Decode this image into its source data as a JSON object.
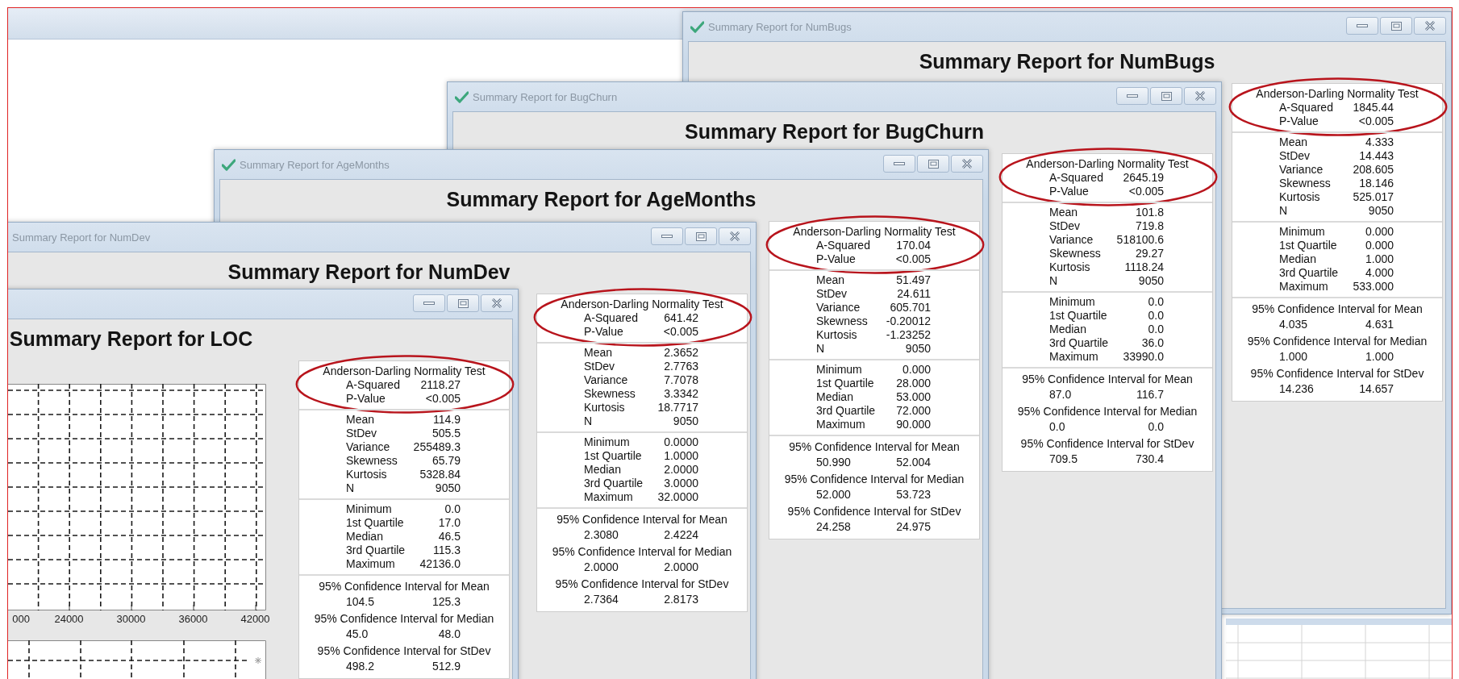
{
  "windows": [
    {
      "title": "Summary Report for NumBugs",
      "title_icon": true,
      "heading": "Summary Report for NumBugs",
      "sections": [
        {
          "kind": "test",
          "title": "Anderson-Darling Normality Test",
          "highlighted": true,
          "rows": [
            [
              "A-Squared",
              "1845.44"
            ],
            [
              "P-Value",
              "<0.005"
            ]
          ]
        },
        {
          "kind": "rows",
          "rows": [
            [
              "Mean",
              "4.333"
            ],
            [
              "StDev",
              "14.443"
            ],
            [
              "Variance",
              "208.605"
            ],
            [
              "Skewness",
              "18.146"
            ],
            [
              "Kurtosis",
              "525.017"
            ],
            [
              "N",
              "9050"
            ]
          ]
        },
        {
          "kind": "rows",
          "rows": [
            [
              "Minimum",
              "0.000"
            ],
            [
              "1st Quartile",
              "0.000"
            ],
            [
              "Median",
              "1.000"
            ],
            [
              "3rd Quartile",
              "4.000"
            ],
            [
              "Maximum",
              "533.000"
            ]
          ]
        },
        {
          "kind": "intervals",
          "items": [
            {
              "title": "95% Confidence Interval for Mean",
              "low": "4.035",
              "high": "4.631"
            },
            {
              "title": "95% Confidence Interval for Median",
              "low": "1.000",
              "high": "1.000"
            },
            {
              "title": "95% Confidence Interval for StDev",
              "low": "14.236",
              "high": "14.657"
            }
          ]
        }
      ]
    },
    {
      "title": "Summary Report for BugChurn",
      "title_icon": true,
      "heading": "Summary Report for BugChurn",
      "sections": [
        {
          "kind": "test",
          "title": "Anderson-Darling Normality Test",
          "highlighted": true,
          "rows": [
            [
              "A-Squared",
              "2645.19"
            ],
            [
              "P-Value",
              "<0.005"
            ]
          ]
        },
        {
          "kind": "rows",
          "rows": [
            [
              "Mean",
              "101.8"
            ],
            [
              "StDev",
              "719.8"
            ],
            [
              "Variance",
              "518100.6"
            ],
            [
              "Skewness",
              "29.27"
            ],
            [
              "Kurtosis",
              "1118.24"
            ],
            [
              "N",
              "9050"
            ]
          ]
        },
        {
          "kind": "rows",
          "rows": [
            [
              "Minimum",
              "0.0"
            ],
            [
              "1st Quartile",
              "0.0"
            ],
            [
              "Median",
              "0.0"
            ],
            [
              "3rd Quartile",
              "36.0"
            ],
            [
              "Maximum",
              "33990.0"
            ]
          ]
        },
        {
          "kind": "intervals",
          "items": [
            {
              "title": "95% Confidence Interval for Mean",
              "low": "87.0",
              "high": "116.7"
            },
            {
              "title": "95% Confidence Interval for Median",
              "low": "0.0",
              "high": "0.0"
            },
            {
              "title": "95% Confidence Interval for StDev",
              "low": "709.5",
              "high": "730.4"
            }
          ]
        }
      ]
    },
    {
      "title": "Summary Report for AgeMonths",
      "title_icon": true,
      "heading": "Summary Report for AgeMonths",
      "sections": [
        {
          "kind": "test",
          "title": "Anderson-Darling Normality Test",
          "highlighted": true,
          "rows": [
            [
              "A-Squared",
              "170.04"
            ],
            [
              "P-Value",
              "<0.005"
            ]
          ]
        },
        {
          "kind": "rows",
          "rows": [
            [
              "Mean",
              "51.497"
            ],
            [
              "StDev",
              "24.611"
            ],
            [
              "Variance",
              "605.701"
            ],
            [
              "Skewness",
              "-0.20012"
            ],
            [
              "Kurtosis",
              "-1.23252"
            ],
            [
              "N",
              "9050"
            ]
          ]
        },
        {
          "kind": "rows",
          "rows": [
            [
              "Minimum",
              "0.000"
            ],
            [
              "1st Quartile",
              "28.000"
            ],
            [
              "Median",
              "53.000"
            ],
            [
              "3rd Quartile",
              "72.000"
            ],
            [
              "Maximum",
              "90.000"
            ]
          ]
        },
        {
          "kind": "intervals",
          "items": [
            {
              "title": "95% Confidence Interval for Mean",
              "low": "50.990",
              "high": "52.004"
            },
            {
              "title": "95% Confidence Interval for Median",
              "low": "52.000",
              "high": "53.723"
            },
            {
              "title": "95% Confidence Interval for StDev",
              "low": "24.258",
              "high": "24.975"
            }
          ]
        }
      ]
    },
    {
      "title": "Summary Report for NumDev",
      "title_icon": false,
      "heading": "Summary Report for NumDev",
      "sections": [
        {
          "kind": "test",
          "title": "Anderson-Darling Normality Test",
          "highlighted": true,
          "rows": [
            [
              "A-Squared",
              "641.42"
            ],
            [
              "P-Value",
              "<0.005"
            ]
          ]
        },
        {
          "kind": "rows",
          "rows": [
            [
              "Mean",
              "2.3652"
            ],
            [
              "StDev",
              "2.7763"
            ],
            [
              "Variance",
              "7.7078"
            ],
            [
              "Skewness",
              "3.3342"
            ],
            [
              "Kurtosis",
              "18.7717"
            ],
            [
              "N",
              "9050"
            ]
          ]
        },
        {
          "kind": "rows",
          "rows": [
            [
              "Minimum",
              "0.0000"
            ],
            [
              "1st Quartile",
              "1.0000"
            ],
            [
              "Median",
              "2.0000"
            ],
            [
              "3rd Quartile",
              "3.0000"
            ],
            [
              "Maximum",
              "32.0000"
            ]
          ]
        },
        {
          "kind": "intervals",
          "items": [
            {
              "title": "95% Confidence Interval for Mean",
              "low": "2.3080",
              "high": "2.4224"
            },
            {
              "title": "95% Confidence Interval for Median",
              "low": "2.0000",
              "high": "2.0000"
            },
            {
              "title": "95% Confidence Interval for StDev",
              "low": "2.7364",
              "high": "2.8173"
            }
          ]
        }
      ]
    },
    {
      "heading": "Summary Report for LOC",
      "chart": {
        "tick_labels": [
          "000",
          "24000",
          "30000",
          "36000",
          "42000"
        ]
      },
      "sections": [
        {
          "kind": "test",
          "title": "Anderson-Darling Normality Test",
          "highlighted": true,
          "rows": [
            [
              "A-Squared",
              "2118.27"
            ],
            [
              "P-Value",
              "<0.005"
            ]
          ]
        },
        {
          "kind": "rows",
          "rows": [
            [
              "Mean",
              "114.9"
            ],
            [
              "StDev",
              "505.5"
            ],
            [
              "Variance",
              "255489.3"
            ],
            [
              "Skewness",
              "65.79"
            ],
            [
              "Kurtosis",
              "5328.84"
            ],
            [
              "N",
              "9050"
            ]
          ]
        },
        {
          "kind": "rows",
          "rows": [
            [
              "Minimum",
              "0.0"
            ],
            [
              "1st Quartile",
              "17.0"
            ],
            [
              "Median",
              "46.5"
            ],
            [
              "3rd Quartile",
              "115.3"
            ],
            [
              "Maximum",
              "42136.0"
            ]
          ]
        },
        {
          "kind": "intervals",
          "items": [
            {
              "title": "95% Confidence Interval for Mean",
              "low": "104.5",
              "high": "125.3"
            },
            {
              "title": "95% Confidence Interval for Median",
              "low": "45.0",
              "high": "48.0"
            },
            {
              "title": "95% Confidence Interval for StDev",
              "low": "498.2",
              "high": "512.9"
            }
          ]
        }
      ]
    }
  ]
}
